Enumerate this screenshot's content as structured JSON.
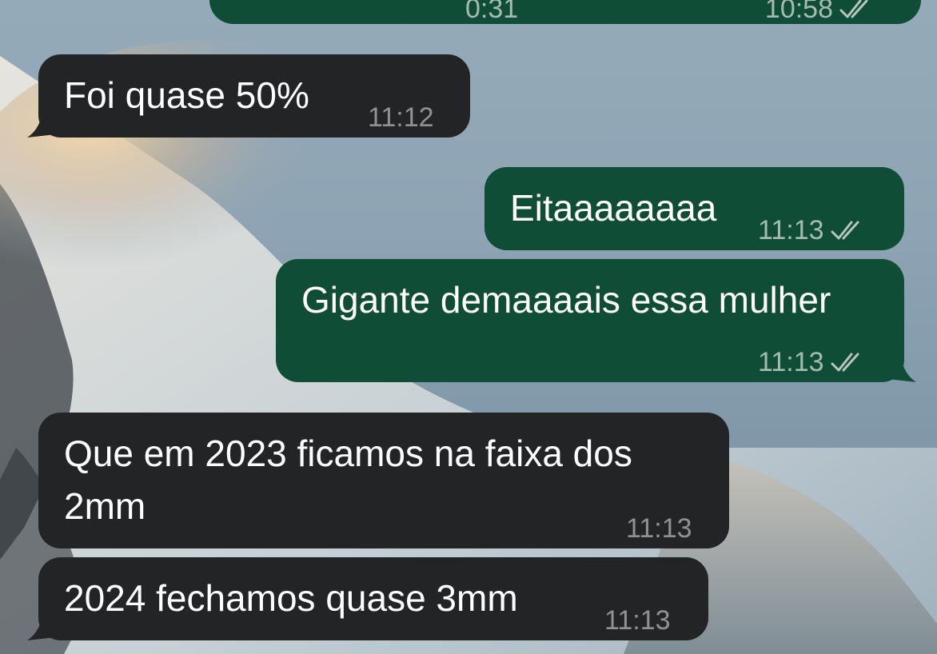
{
  "messages": [
    {
      "id": "prev",
      "direction": "outgoing",
      "text": "",
      "time_left": "0:31",
      "time": "10:58",
      "status": "read"
    },
    {
      "id": "m1",
      "direction": "incoming",
      "text": "Foi quase 50%",
      "time": "11:12"
    },
    {
      "id": "m2",
      "direction": "outgoing",
      "text": "Eitaaaaaaaa",
      "time": "11:13",
      "status": "read"
    },
    {
      "id": "m3",
      "direction": "outgoing",
      "text": "Gigante demaaaais essa mulher",
      "time": "11:13",
      "status": "read"
    },
    {
      "id": "m4",
      "direction": "incoming",
      "text_line1": "Que em 2023 ficamos na faixa dos",
      "text_line2": "2mm",
      "time": "11:13"
    },
    {
      "id": "m5",
      "direction": "incoming",
      "text": "2024 fechamos quase 3mm",
      "time": "11:13"
    }
  ],
  "colors": {
    "incoming_bubble": "#232426",
    "outgoing_bubble": "#0f4d36",
    "read_ticks": "#b8c6c0"
  },
  "icons": {
    "read_status": "double-check-icon",
    "wallpaper": "mountain-wallpaper"
  }
}
